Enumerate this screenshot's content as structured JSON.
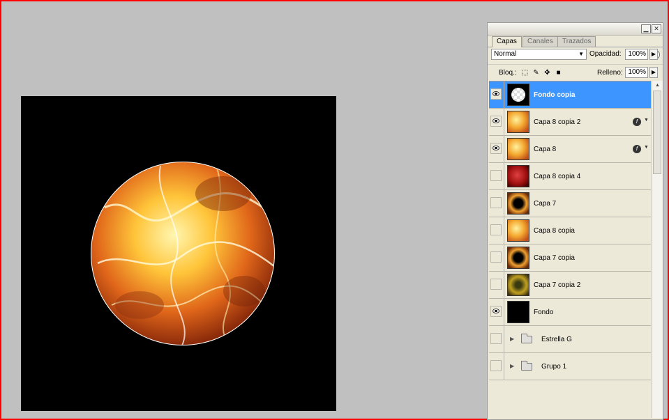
{
  "panel": {
    "tabs": [
      "Capas",
      "Canales",
      "Trazados"
    ],
    "blend_mode": "Normal",
    "opacity_label": "Opacidad:",
    "opacity_value": "100%",
    "lock_label": "Bloq.:",
    "fill_label": "Relleno:",
    "fill_value": "100%"
  },
  "layers": [
    {
      "name": "Fondo copia",
      "visible": true,
      "selected": true,
      "thumb": "circle-transparent",
      "fx": false
    },
    {
      "name": "Capa 8 copia 2",
      "visible": true,
      "selected": false,
      "thumb": "fire",
      "fx": true
    },
    {
      "name": "Capa 8",
      "visible": true,
      "selected": false,
      "thumb": "fire",
      "fx": true
    },
    {
      "name": "Capa 8 copia 4",
      "visible": false,
      "selected": false,
      "thumb": "red-fire",
      "fx": false
    },
    {
      "name": "Capa 7",
      "visible": false,
      "selected": false,
      "thumb": "dark-fire",
      "fx": false
    },
    {
      "name": "Capa 8 copia",
      "visible": false,
      "selected": false,
      "thumb": "fire",
      "fx": false
    },
    {
      "name": "Capa 7 copia",
      "visible": false,
      "selected": false,
      "thumb": "dark-fire",
      "fx": false
    },
    {
      "name": "Capa 7 copia 2",
      "visible": false,
      "selected": false,
      "thumb": "olive-fire",
      "fx": false
    },
    {
      "name": "Fondo",
      "visible": true,
      "selected": false,
      "thumb": "black",
      "fx": false
    },
    {
      "name": "Estrella G",
      "visible": false,
      "selected": false,
      "thumb": "group",
      "fx": false
    },
    {
      "name": "Grupo 1",
      "visible": false,
      "selected": false,
      "thumb": "group",
      "fx": false
    }
  ]
}
